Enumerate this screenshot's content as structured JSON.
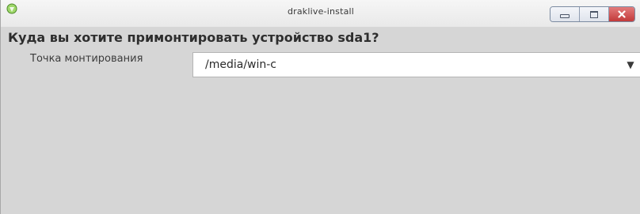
{
  "window": {
    "title": "draklive-install",
    "controls": {
      "minimize_icon": "minimize-icon",
      "maximize_icon": "maximize-icon",
      "close_icon": "close-icon"
    }
  },
  "dialog": {
    "question": "Куда вы хотите примонтировать устройство sda1?",
    "mount_point": {
      "label": "Точка монтирования",
      "value": "/media/win-c",
      "dropdown_icon": "chevron-down-icon"
    }
  },
  "colors": {
    "background": "#d6d6d6",
    "close_button": "#c94545",
    "app_icon": "#7cc242"
  }
}
